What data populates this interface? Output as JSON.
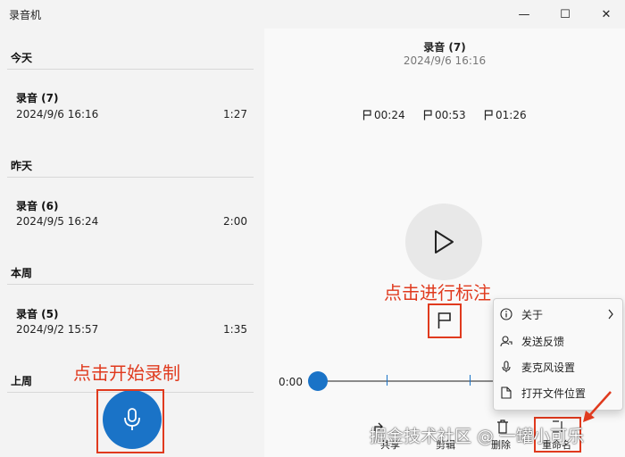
{
  "window": {
    "title": "录音机",
    "minimize_glyph": "—",
    "maximize_glyph": "☐",
    "close_glyph": "✕"
  },
  "recordings": {
    "groups": [
      {
        "heading": "今天",
        "items": [
          {
            "title": "录音 (7)",
            "date": "2024/9/6 16:16",
            "duration": "1:27"
          }
        ]
      },
      {
        "heading": "昨天",
        "items": [
          {
            "title": "录音 (6)",
            "date": "2024/9/5 16:24",
            "duration": "2:00"
          }
        ]
      },
      {
        "heading": "本周",
        "items": [
          {
            "title": "录音 (5)",
            "date": "2024/9/2 15:57",
            "duration": "1:35"
          }
        ]
      },
      {
        "heading": "上周",
        "items": []
      }
    ]
  },
  "detail": {
    "title": "录音 (7)",
    "date": "2024/9/6 16:16",
    "markers": [
      "00:24",
      "00:53",
      "01:26"
    ],
    "time_start": "0:00",
    "playback_position": 0
  },
  "context_menu": {
    "items": [
      {
        "label": "关于",
        "icon": "info-icon"
      },
      {
        "label": "发送反馈",
        "icon": "feedback-icon"
      },
      {
        "label": "麦克风设置",
        "icon": "microphone-icon"
      },
      {
        "label": "打开文件位置",
        "icon": "file-icon"
      }
    ]
  },
  "toolbar": {
    "share_label": "共享",
    "trim_label": "剪辑",
    "delete_label": "删除",
    "rename_label": "重命名"
  },
  "annotations": {
    "mark_hint": "点击进行标注",
    "record_hint": "点击开始录制"
  },
  "watermark": "掘金技术社区 @ 一罐小可乐",
  "colors": {
    "accent": "#1a73c7",
    "annotation": "#e03a1e"
  }
}
